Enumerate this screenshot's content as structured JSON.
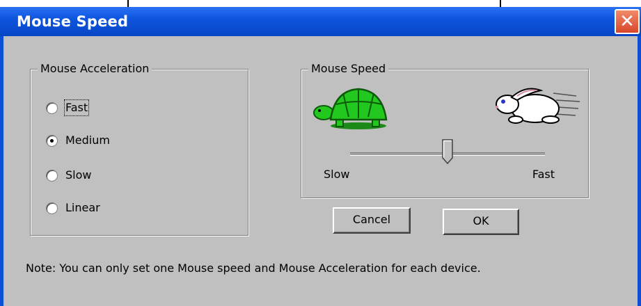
{
  "window": {
    "title": "Mouse Speed",
    "close_symbol": "✕",
    "close_icon": "close-icon"
  },
  "acceleration": {
    "legend": "Mouse Acceleration",
    "options": [
      {
        "label": "Fast",
        "checked": false
      },
      {
        "label": "Medium",
        "checked": true
      },
      {
        "label": "Slow",
        "checked": false
      },
      {
        "label": "Linear",
        "checked": false
      }
    ],
    "selected": "Medium"
  },
  "speed": {
    "legend": "Mouse Speed",
    "slow_label": "Slow",
    "fast_label": "Fast",
    "value_fraction": 0.5,
    "slow_icon": "turtle-icon",
    "fast_icon": "rabbit-icon"
  },
  "buttons": {
    "cancel": "Cancel",
    "ok": "OK"
  },
  "note": "Note:  You can only set one Mouse speed and Mouse Acceleration for each device.",
  "colors": {
    "titlebar": "#0d55de",
    "face": "#c0c0c0",
    "turtle_green": "#22c81e",
    "close_red": "#d8472a"
  }
}
